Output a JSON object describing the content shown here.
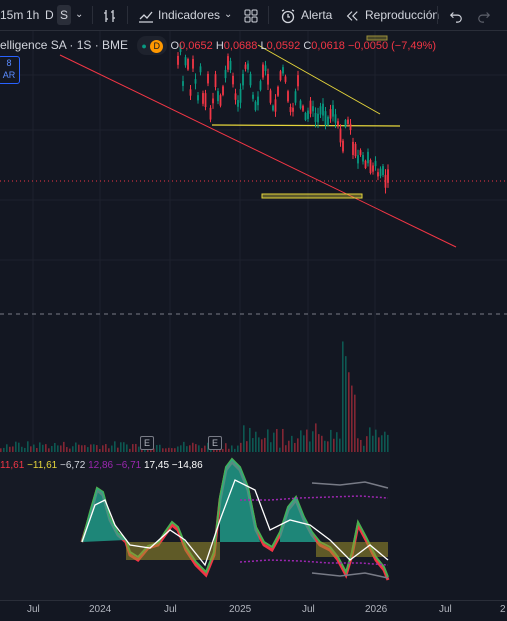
{
  "toolbar": {
    "interval_15m": "15m",
    "interval_1h": "1h",
    "interval_d": "D",
    "interval_s": "S",
    "indicators_label": "Indicadores",
    "alert_label": "Alerta",
    "replay_label": "Reproducción"
  },
  "legend": {
    "symbol": "elligence SA · 1S · BME",
    "open_label": "O",
    "open": "0,0652",
    "high_label": "H",
    "high": "0,0688",
    "low_label": "L",
    "low": "0,0592",
    "close_label": "C",
    "close": "0,0618",
    "change": "−0,0050 (−7,49%)",
    "d_badge": "D"
  },
  "side_badge": {
    "line1": "8",
    "line2": "AR"
  },
  "indicator_legend": {
    "v1": "11,61",
    "v2": "−11,61",
    "v3": "−6,72",
    "v4": "12,86",
    "v5": "−6,71",
    "v6": "17,45",
    "v7": "−14,86"
  },
  "event_badges": [
    "E",
    "E"
  ],
  "x_axis": [
    "Jul",
    "2024",
    "Jul",
    "2025",
    "Jul",
    "2026",
    "Jul",
    "2"
  ],
  "colors": {
    "bg": "#131722",
    "up": "#089981",
    "down": "#f23645",
    "trendline_red": "#f23645",
    "trendline_yellow": "#e5d53b",
    "accent": "#2962ff"
  }
}
